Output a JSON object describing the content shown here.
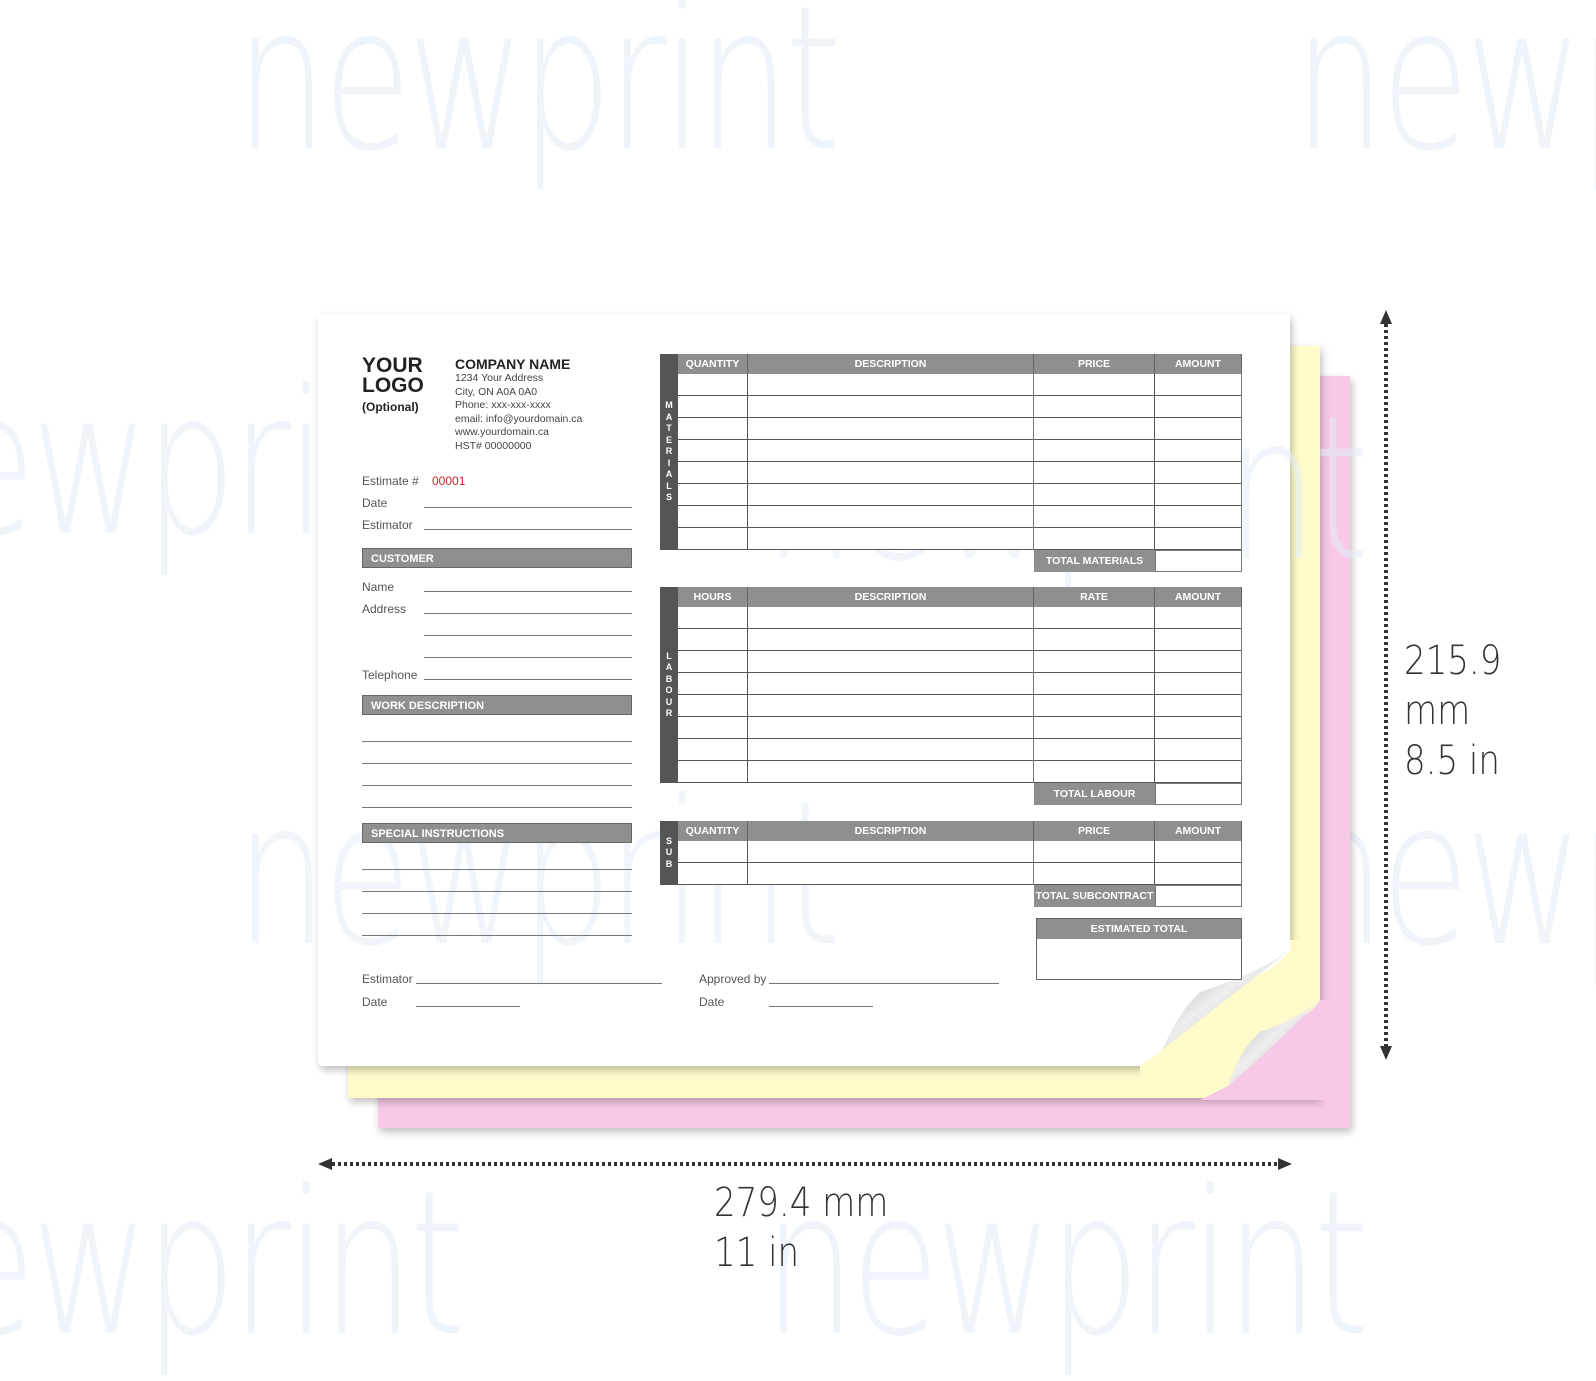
{
  "watermark": "newprint",
  "company": {
    "logo_line1": "YOUR",
    "logo_line2": "LOGO",
    "logo_note": "(Optional)",
    "name": "COMPANY NAME",
    "address": "1234 Your Address",
    "city": "City, ON A0A 0A0",
    "phone": "Phone: xxx-xxx-xxxx",
    "email": "email: info@yourdomain.ca",
    "web": "www.yourdomain.ca",
    "hst": "HST# 00000000"
  },
  "estimate": {
    "number_label": "Estimate #",
    "number_value": "00001",
    "date_label": "Date",
    "estimator_label": "Estimator"
  },
  "customer": {
    "header": "CUSTOMER",
    "name_label": "Name",
    "address_label": "Address",
    "telephone_label": "Telephone"
  },
  "work_description": {
    "header": "WORK DESCRIPTION"
  },
  "special_instructions": {
    "header": "SPECIAL INSTRUCTIONS"
  },
  "materials": {
    "side_label": [
      "M",
      "A",
      "T",
      "E",
      "R",
      "I",
      "A",
      "L",
      "S"
    ],
    "columns": [
      "QUANTITY",
      "DESCRIPTION",
      "PRICE",
      "AMOUNT"
    ],
    "row_count": 8,
    "total_label": "TOTAL MATERIALS"
  },
  "labour": {
    "side_label": [
      "L",
      "A",
      "B",
      "O",
      "U",
      "R"
    ],
    "columns": [
      "HOURS",
      "DESCRIPTION",
      "RATE",
      "AMOUNT"
    ],
    "row_count": 8,
    "total_label": "TOTAL LABOUR"
  },
  "subcontract": {
    "side_label": [
      "S",
      "U",
      "B"
    ],
    "columns": [
      "QUANTITY",
      "DESCRIPTION",
      "PRICE",
      "AMOUNT"
    ],
    "row_count": 2,
    "total_label": "TOTAL SUBCONTRACT"
  },
  "estimated_total": {
    "header": "ESTIMATED TOTAL"
  },
  "signatures": {
    "estimator_label": "Estimator",
    "date_label": "Date",
    "approved_label": "Approved by",
    "approved_date_label": "Date"
  },
  "dimensions": {
    "height_mm": "215.9 mm",
    "height_in": "8.5 in",
    "width_mm": "279.4 mm",
    "width_in": "11 in"
  },
  "colors": {
    "sheet_white": "#ffffff",
    "sheet_yellow": "#fdfbc9",
    "sheet_pink": "#f7c9e6",
    "header_gray": "#8f8f90",
    "side_gray": "#555555",
    "estimate_number": "#d0202a"
  }
}
